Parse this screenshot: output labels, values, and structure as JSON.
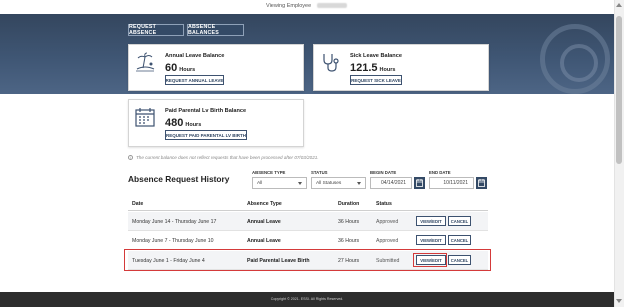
{
  "header": {
    "viewing_label": "Viewing Employee"
  },
  "tabs": [
    {
      "label": "REQUEST ABSENCE"
    },
    {
      "label": "ABSENCE BALANCES"
    }
  ],
  "balances": [
    {
      "title": "Annual Leave Balance",
      "value": "60",
      "unit": "Hours",
      "button": "REQUEST ANNUAL LEAVE",
      "icon": "beach-icon"
    },
    {
      "title": "Sick Leave Balance",
      "value": "121.5",
      "unit": "Hours",
      "button": "REQUEST SICK LEAVE",
      "icon": "stethoscope-icon"
    },
    {
      "title": "Paid Parental Lv Birth Balance",
      "value": "480",
      "unit": "Hours",
      "button": "REQUEST PAID PARENTAL LV BIRTH",
      "icon": "calendar-icon"
    }
  ],
  "note": "The current balance does not reflect requests that have been processed after 07/03/2021.",
  "history": {
    "title": "Absence Request History",
    "filters": {
      "absence_type": {
        "label": "ABSENCE TYPE",
        "value": "All"
      },
      "status": {
        "label": "STATUS",
        "value": "All Statuses"
      },
      "begin_date": {
        "label": "BEGIN DATE",
        "value": "04/14/2021"
      },
      "end_date": {
        "label": "END DATE",
        "value": "10/11/2021"
      }
    },
    "columns": [
      "Date",
      "Absence Type",
      "Duration",
      "Status"
    ],
    "rows": [
      {
        "date": "Monday June 14 - Thursday June 17",
        "type": "Annual Leave",
        "duration": "36 Hours",
        "status": "Approved",
        "view": "VIEW/EDIT",
        "cancel": "CANCEL"
      },
      {
        "date": "Monday June 7 - Thursday June 10",
        "type": "Annual Leave",
        "duration": "36 Hours",
        "status": "Approved",
        "view": "VIEW/EDIT",
        "cancel": "CANCEL"
      },
      {
        "date": "Tuesday June 1 - Friday June 4",
        "type": "Paid Parental Leave Birth",
        "duration": "27 Hours",
        "status": "Submitted",
        "view": "VIEW/EDIT",
        "cancel": "CANCEL"
      }
    ]
  },
  "footer": {
    "text": "Copyright © 2021. ESSI. All Rights Reserved."
  },
  "colors": {
    "navy": "#344a66",
    "highlight": "#d43a3a",
    "footer": "#2d2d2d"
  }
}
